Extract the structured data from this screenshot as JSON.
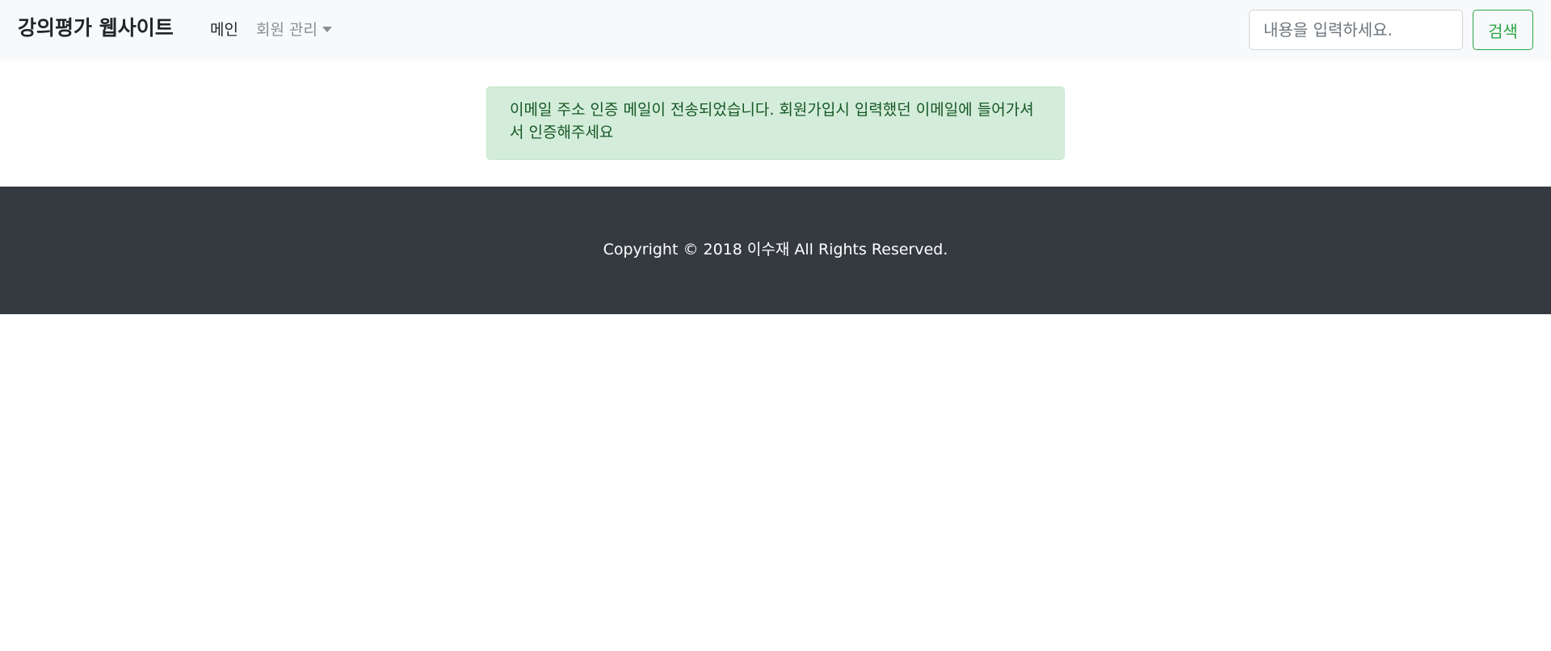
{
  "navbar": {
    "brand": "강의평가 웹사이트",
    "links": {
      "main": "메인",
      "member_management": "회원 관리"
    },
    "search": {
      "placeholder": "내용을 입력하세요.",
      "value": "",
      "button_label": "검색"
    }
  },
  "alert": {
    "message": "이메일 주소 인증 메일이 전송되었습니다. 회원가입시 입력했던 이메일에 들어가셔서 인증해주세요"
  },
  "footer": {
    "copyright": "Copyright © 2018 이수재 All Rights Reserved."
  },
  "colors": {
    "navbar_bg": "#f8f9fa",
    "alert_bg": "#d4edda",
    "alert_text": "#155724",
    "success_accent": "#28a745",
    "footer_bg": "#343a40"
  },
  "icons": {
    "dropdown": "caret-down-icon"
  }
}
